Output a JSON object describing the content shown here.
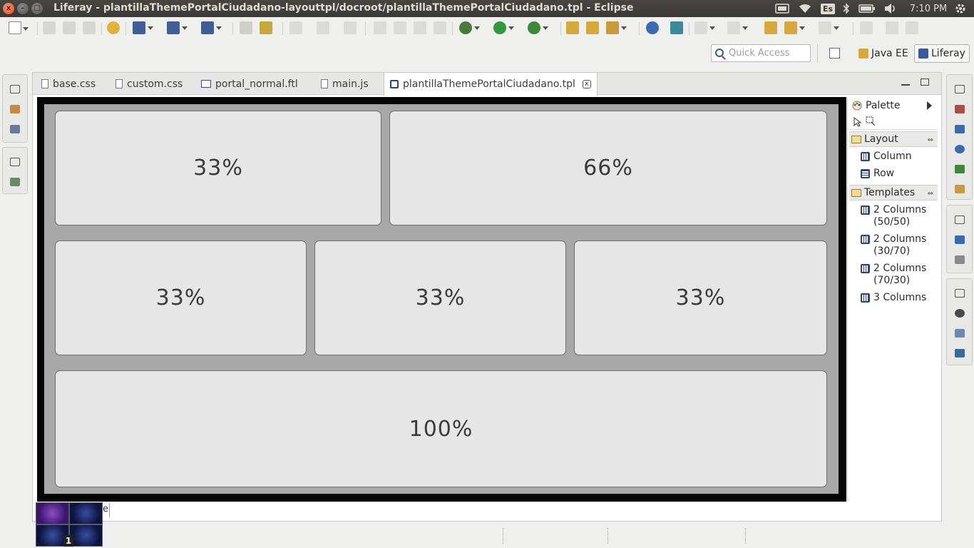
{
  "window": {
    "title": "Liferay - plantillaThemePortalCiudadano-layouttpl/docroot/plantillaThemePortalCiudadano.tpl - Eclipse",
    "close": "x",
    "minimize": "–",
    "maximize": "□"
  },
  "system_tray": {
    "keyboard_layout": "Es",
    "clock": "7:10 PM"
  },
  "toolbar": {
    "icons": [
      "new-icon",
      "save-icon",
      "save-all-icon",
      "print-icon",
      "liferay-icon",
      "new-project-icon",
      "new-class-icon",
      "new-template-icon",
      "next-annotation-icon",
      "prev-annotation-icon",
      "step-into-icon",
      "step-over-icon",
      "step-return-icon",
      "resume-icon",
      "suspend-icon",
      "terminate-icon",
      "disconnect-icon",
      "debug-icon",
      "run-icon",
      "external-tools-icon",
      "open-type-icon",
      "open-task-icon",
      "search-icon",
      "globe-icon",
      "web-browser-icon",
      "last-edit-icon",
      "back-icon",
      "forward-icon"
    ]
  },
  "quick_access": {
    "placeholder": "Quick Access"
  },
  "perspectives": {
    "java_ee": "Java EE",
    "liferay": "Liferay"
  },
  "tabs": [
    {
      "label": "base.css",
      "icon": "css-file-icon"
    },
    {
      "label": "custom.css",
      "icon": "css-file-icon"
    },
    {
      "label": "portal_normal.ftl",
      "icon": "ftl-file-icon"
    },
    {
      "label": "main.js",
      "icon": "js-file-icon"
    },
    {
      "label": "plantillaThemePortalCiudadano.tpl",
      "icon": "layout-template-icon",
      "active": true,
      "close": "x"
    }
  ],
  "layout": {
    "rows": [
      {
        "columns": [
          "33%",
          "66%"
        ]
      },
      {
        "columns": [
          "33%",
          "33%",
          "33%"
        ]
      },
      {
        "columns": [
          "100%"
        ]
      }
    ]
  },
  "palette": {
    "title": "Palette",
    "drawers": [
      {
        "label": "Layout",
        "items": [
          "Column",
          "Row"
        ]
      },
      {
        "label": "Templates",
        "items": [
          "2 Columns (50/50)",
          "2 Columns (30/70)",
          "2 Columns (70/30)",
          "3 Columns"
        ]
      }
    ]
  },
  "bottom": {
    "text": "e",
    "workspace_number": "1"
  },
  "colors": {
    "title_bar": "#3c3b37",
    "canvas_border": "#050505",
    "canvas_bg": "#a8a8a8",
    "cell_bg": "#e6e6e6",
    "close_button": "#df4a16",
    "template_icon": "#34427a"
  }
}
